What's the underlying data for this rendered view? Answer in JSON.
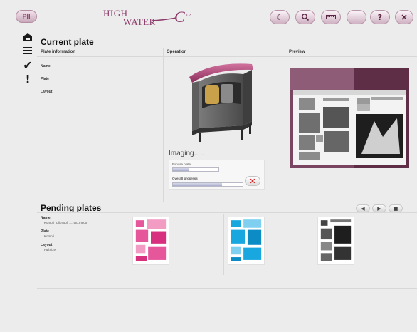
{
  "toolbar": {
    "pii_label": "PII",
    "logo_high": "HIGH",
    "logo_water": "WATER",
    "logo_c": "C",
    "logo_tp": "TP"
  },
  "current_plate": {
    "title": "Current plate",
    "col_info": "Plate information",
    "col_operation": "Operation",
    "col_preview": "Preview",
    "fields": [
      {
        "label": "Name"
      },
      {
        "label": "Plate"
      },
      {
        "label": "Layout"
      }
    ]
  },
  "imaging": {
    "title": "Imaging.....",
    "expose_label": "Expose plate",
    "expose_progress": 0.35,
    "overall_label": "Overall progress",
    "overall_progress": 0.7
  },
  "pending": {
    "title": "Pending plates",
    "fields": [
      {
        "label": "Name",
        "value": "Komori_ClipTool_1.75to.m800"
      },
      {
        "label": "Plate",
        "value": "Komori"
      },
      {
        "label": "Layout",
        "value": "FullSize"
      }
    ]
  },
  "colors": {
    "brand": "#8c3a6a",
    "magenta_plate": "#e5569a",
    "cyan_plate": "#19a7df",
    "progress": "#a8adcb",
    "cancel": "#d21b1b"
  },
  "icons": {
    "tools": [
      "moon-icon",
      "search-icon",
      "ruler-icon",
      "blank-icon",
      "help-icon",
      "close-icon"
    ],
    "side": [
      "printer-icon",
      "list-icon",
      "check-icon",
      "alert-icon"
    ],
    "pager": [
      "previous-icon",
      "play-icon",
      "stop-icon"
    ]
  }
}
